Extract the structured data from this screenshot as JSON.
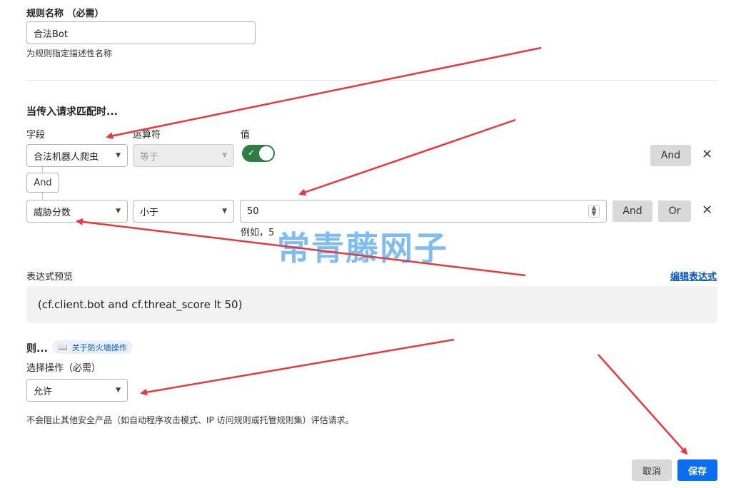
{
  "rule_name": {
    "label": "规则名称 （必需）",
    "value": "合法Bot",
    "help": "为规则指定描述性名称"
  },
  "match": {
    "heading": "当传入请求匹配时...",
    "col_field": "字段",
    "col_operator": "运算符",
    "col_value": "值",
    "row1": {
      "field": "合法机器人爬虫",
      "operator": "等于",
      "toggle_on": true,
      "and_label": "And"
    },
    "connector": "And",
    "row2": {
      "field": "威胁分数",
      "operator": "小于",
      "value": "50",
      "example": "例如，5",
      "and_label": "And",
      "or_label": "Or"
    }
  },
  "expression": {
    "label": "表达式预览",
    "edit_link": "编辑表达式",
    "preview": "(cf.client.bot and cf.threat_score lt 50)"
  },
  "action": {
    "heading": "则...",
    "tag": "关于防火墙操作",
    "label": "选择操作（必需）",
    "value": "允许",
    "note": "不会阻止其他安全产品（如自动程序攻击模式、IP 访问规则或托管规则集）评估请求。"
  },
  "footer": {
    "cancel": "取消",
    "save": "保存"
  },
  "watermark": "常青藤网子",
  "colors": {
    "primary": "#0a6ef0",
    "toggle": "#2f7d43",
    "arrow": "#e8383d",
    "link": "#0a55c9"
  },
  "icons": {
    "remove": "close-icon",
    "dropdown": "chevron-down-icon",
    "book": "book-icon",
    "check": "check-icon"
  }
}
